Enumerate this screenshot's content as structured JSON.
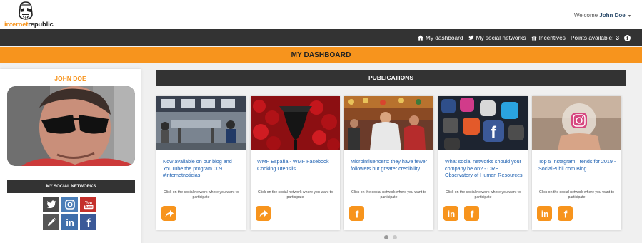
{
  "header": {
    "logo": {
      "part1": "internet",
      "part2": "republic"
    },
    "welcome_prefix": "Welcome",
    "user_name": "John Doe",
    "caret": "▾"
  },
  "nav": {
    "dashboard": "My dashboard",
    "social": "My social networks",
    "incentives": "Incentives",
    "points_label": "Points available:",
    "points_value": "3"
  },
  "dashboard_title": "MY DASHBOARD",
  "profile": {
    "name": "JOHN DOE",
    "social_header": "MY SOCIAL NETWORKS",
    "social_buttons": [
      {
        "name": "twitter",
        "color": "#4a4a4a"
      },
      {
        "name": "instagram",
        "color": "#4b7fb8"
      },
      {
        "name": "youtube",
        "color": "#c4302b"
      },
      {
        "name": "edit",
        "color": "#555555"
      },
      {
        "name": "linkedin",
        "color": "#3f6fab"
      },
      {
        "name": "facebook",
        "color": "#3b5998"
      }
    ]
  },
  "publications": {
    "title": "PUBLICATIONS",
    "cards": [
      {
        "title": "Now available on our blog and YouTube the program 009 #internetnoticias",
        "instruction": "Click on the social network where you want to participate",
        "buttons": [
          "share"
        ]
      },
      {
        "title": "WMF España - WMF Facebook Cooking Utensils",
        "instruction": "Click on the social network where you want to participate",
        "buttons": [
          "share"
        ]
      },
      {
        "title": "Microinfluencers: they have fewer followers but greater credibility",
        "instruction": "Click on the social network where you want to participate",
        "buttons": [
          "facebook"
        ]
      },
      {
        "title": "What social networks should your company be on? - ORH Observatory of Human Resources",
        "instruction": "Click on the social network where you want to participate",
        "buttons": [
          "linkedin",
          "facebook"
        ]
      },
      {
        "title": "Top 5 Instagram Trends for 2019 - SocialPubli.com Blog",
        "instruction": "Click on the social network where you want to participate",
        "buttons": [
          "linkedin",
          "facebook"
        ]
      }
    ],
    "pagination": {
      "pages": 2,
      "current": 1
    }
  },
  "colors": {
    "accent": "#f7941d",
    "dark": "#333333",
    "link": "#1c5fb0"
  }
}
